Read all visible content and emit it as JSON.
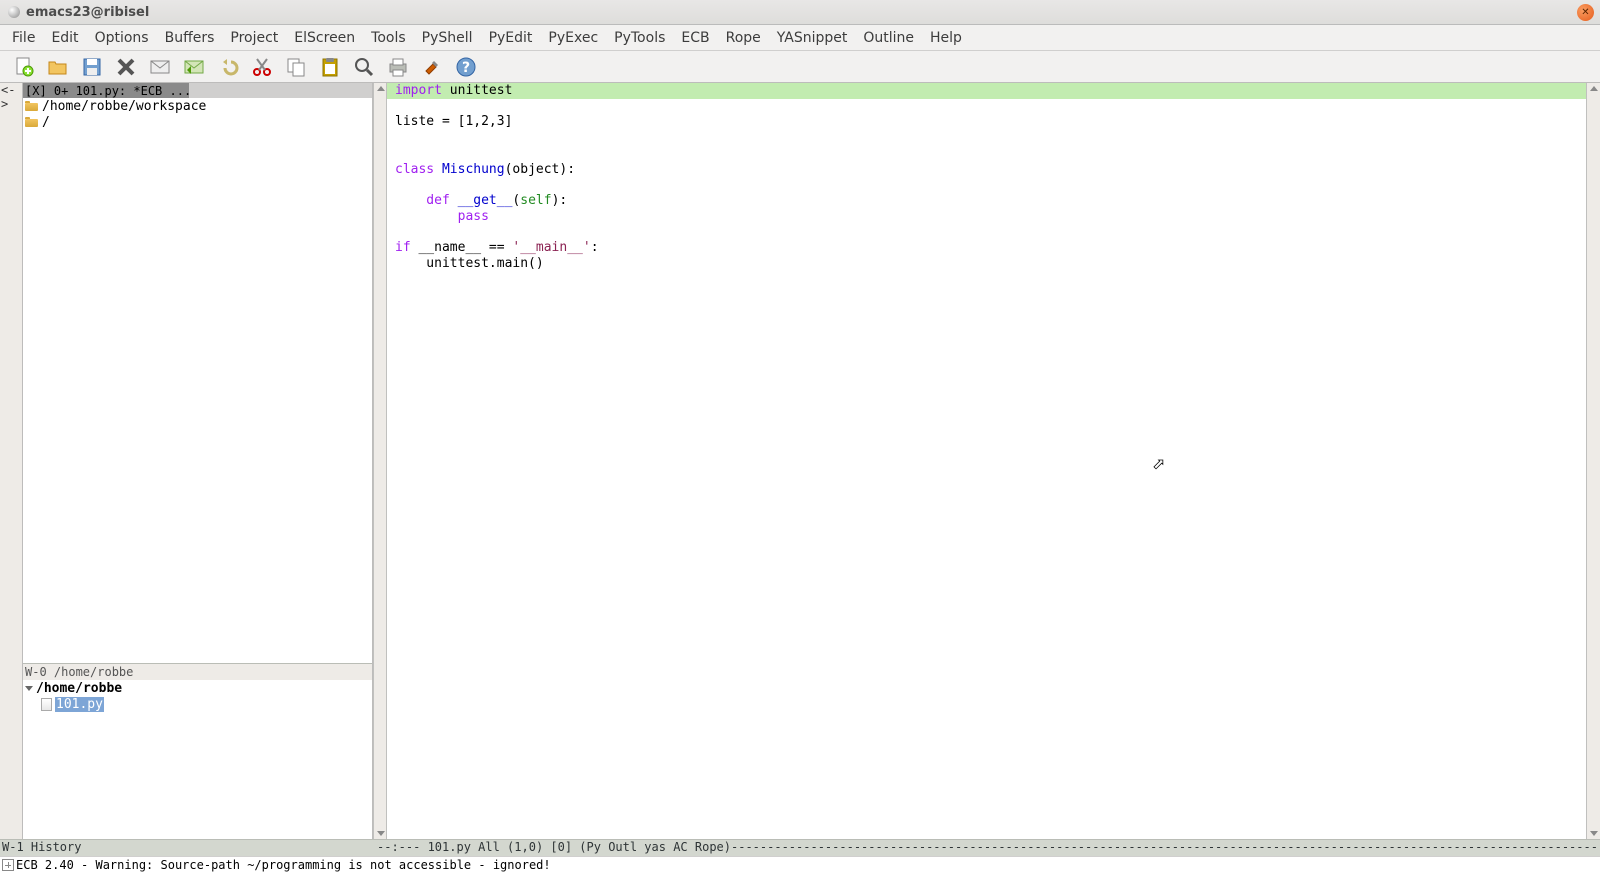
{
  "window": {
    "title": "emacs23@ribisel"
  },
  "menu": [
    "File",
    "Edit",
    "Options",
    "Buffers",
    "Project",
    "ElScreen",
    "Tools",
    "PyShell",
    "PyEdit",
    "PyExec",
    "PyTools",
    "ECB",
    "Rope",
    "YASnippet",
    "Outline",
    "Help"
  ],
  "toolbar_icons": [
    "new-file",
    "open-file",
    "save",
    "close",
    "mail",
    "reply",
    "undo",
    "cut",
    "copy",
    "paste",
    "search",
    "print",
    "tools",
    "help"
  ],
  "gutter_header": "<->",
  "tabs_line": "[X] 0+ 101.py: *ECB ...",
  "tree1": {
    "items": [
      {
        "icon": "folder",
        "label": "/home/robbe/workspace"
      },
      {
        "icon": "folder",
        "label": "/"
      }
    ]
  },
  "modeline_w0": "W-0 /home/robbe",
  "tree2": {
    "root": "/home/robbe",
    "selected": "101.py"
  },
  "modeline_w1_left": "W-1 History",
  "modeline_right": "--:---  101.py      All (1,0)     [0]  (Py Outl yas AC Rope)------------------------------------------------------------------------------------------------------------------------------",
  "minibuffer": "ECB 2.40 - Warning: Source-path ~/programming is not accessible - ignored!",
  "code": {
    "l1_import": "import",
    "l1_rest": " unittest",
    "l3": "liste = [1,2,3]",
    "l6_class": "class",
    "l6_name": " Mischung",
    "l6_rest": "(object):",
    "l8_def": "    def ",
    "l8_name": "__get__",
    "l8_open": "(",
    "l8_self": "self",
    "l8_close": "):",
    "l9": "        pass",
    "l11_if": "if",
    "l11_mid": " __name__ == ",
    "l11_str": "'__main__'",
    "l11_end": ":",
    "l12": "    unittest.main()"
  }
}
